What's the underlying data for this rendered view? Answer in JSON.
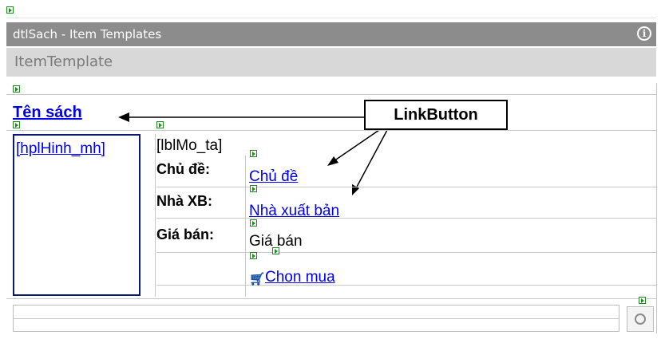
{
  "window": {
    "title": "dtlSach - Item Templates",
    "subtitle": "ItemTemplate",
    "info_icon": "info-icon"
  },
  "template": {
    "title_link": "Tên sách",
    "image_link": "[hplHinh_mh]",
    "description": "[lblMo_ta]",
    "fields": [
      {
        "label": "Chủ đề:",
        "value": "Chủ đề",
        "is_link": true
      },
      {
        "label": "Nhà XB:",
        "value": "Nhà xuất bản",
        "is_link": true
      },
      {
        "label": "Giá bán:",
        "value": "Giá bán",
        "is_link": false
      }
    ],
    "buy_link": "Chon mua",
    "buy_icon": "cart-icon"
  },
  "annotation": {
    "callout": "LinkButton"
  },
  "footer": {
    "refresh_icon": "refresh-icon"
  },
  "colors": {
    "titlebar": "#8c8c8c",
    "subbar": "#d8d8d8",
    "link": "#0000ee",
    "tag": "#1f8a1f"
  }
}
